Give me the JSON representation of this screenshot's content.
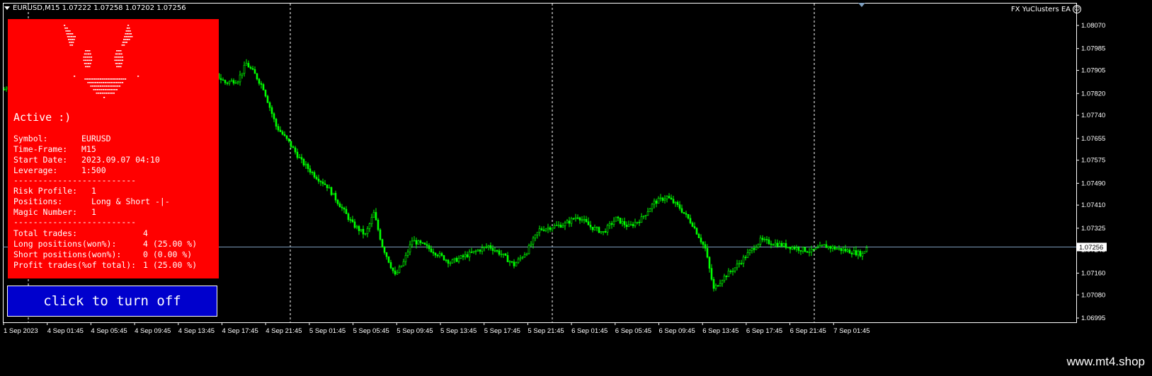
{
  "header": {
    "symbol_line": "EURUSD,M15  1.07222 1.07258 1.07202 1.07256"
  },
  "ea_label": {
    "text": "FX YuClusters EA",
    "icon": "smiley-icon"
  },
  "info_panel": {
    "status": "Active :)",
    "rows1": [
      {
        "key": "Symbol:",
        "value": "EURUSD"
      },
      {
        "key": "Time-Frame:",
        "value": "M15"
      },
      {
        "key": "Start Date:",
        "value": "2023.09.07 04:10"
      },
      {
        "key": "Leverage:",
        "value": "1:500"
      }
    ],
    "separator": "-------------------------",
    "rows2": [
      {
        "key": "Risk Profile:",
        "value": "1"
      },
      {
        "key": "Positions:",
        "value": "Long & Short -|-"
      },
      {
        "key": "Magic Number:",
        "value": "1"
      }
    ],
    "rows3": [
      {
        "key": "Total trades:",
        "value": "4"
      },
      {
        "key": "Long positions(won%):",
        "value": "4 (25.00 %)"
      },
      {
        "key": "Short positions(won%):",
        "value": "0 (0.00 %)"
      },
      {
        "key": "Profit trades(%of total):",
        "value": "1 (25.00 %)"
      }
    ],
    "panel_color": "#ff0000"
  },
  "toggle_button": {
    "label": "click to turn off",
    "color": "#0000cd"
  },
  "watermark": "www.mt4.shop",
  "chart_data": {
    "type": "candlestick",
    "symbol": "EURUSD",
    "timeframe": "M15",
    "ylim": [
      1.06995,
      1.0807
    ],
    "y_ticks": [
      "1.08070",
      "1.07985",
      "1.07905",
      "1.07820",
      "1.07740",
      "1.07655",
      "1.07575",
      "1.07490",
      "1.07410",
      "1.07325",
      "1.07245",
      "1.07160",
      "1.07080",
      "1.06995"
    ],
    "current_price": "1.07256",
    "x_ticks": [
      "1 Sep 2023",
      "4 Sep 01:45",
      "4 Sep 05:45",
      "4 Sep 09:45",
      "4 Sep 13:45",
      "4 Sep 17:45",
      "4 Sep 21:45",
      "5 Sep 01:45",
      "5 Sep 05:45",
      "5 Sep 09:45",
      "5 Sep 13:45",
      "5 Sep 17:45",
      "5 Sep 21:45",
      "6 Sep 01:45",
      "6 Sep 05:45",
      "6 Sep 09:45",
      "6 Sep 13:45",
      "6 Sep 17:45",
      "6 Sep 21:45",
      "7 Sep 01:45"
    ],
    "candle_color": "#00ff00",
    "price_path": [
      [
        0,
        1.07835
      ],
      [
        4,
        1.0787
      ],
      [
        8,
        1.0789
      ],
      [
        12,
        1.0786
      ],
      [
        14,
        1.0788
      ],
      [
        18,
        1.0785
      ],
      [
        22,
        1.07905
      ],
      [
        24,
        1.07985
      ],
      [
        28,
        1.0796
      ],
      [
        36,
        1.07955
      ],
      [
        44,
        1.07975
      ],
      [
        52,
        1.0796
      ],
      [
        60,
        1.0794
      ],
      [
        66,
        1.0795
      ],
      [
        70,
        1.07985
      ],
      [
        78,
        1.0796
      ],
      [
        86,
        1.0793
      ],
      [
        92,
        1.0792
      ],
      [
        98,
        1.079
      ],
      [
        104,
        1.0786
      ],
      [
        110,
        1.0787
      ],
      [
        114,
        1.0793
      ],
      [
        118,
        1.0789
      ],
      [
        122,
        1.0784
      ],
      [
        128,
        1.077
      ],
      [
        134,
        1.0764
      ],
      [
        140,
        1.0757
      ],
      [
        146,
        1.0752
      ],
      [
        152,
        1.0748
      ],
      [
        158,
        1.0741
      ],
      [
        164,
        1.0734
      ],
      [
        170,
        1.073
      ],
      [
        174,
        1.0738
      ],
      [
        178,
        1.0726
      ],
      [
        184,
        1.0715
      ],
      [
        188,
        1.072
      ],
      [
        192,
        1.0728
      ],
      [
        198,
        1.0726
      ],
      [
        204,
        1.0723
      ],
      [
        210,
        1.072
      ],
      [
        216,
        1.0722
      ],
      [
        222,
        1.0724
      ],
      [
        228,
        1.0726
      ],
      [
        234,
        1.0723
      ],
      [
        240,
        1.0719
      ],
      [
        246,
        1.0724
      ],
      [
        252,
        1.0732
      ],
      [
        258,
        1.0733
      ],
      [
        264,
        1.0734
      ],
      [
        270,
        1.0737
      ],
      [
        276,
        1.0733
      ],
      [
        282,
        1.0731
      ],
      [
        288,
        1.0736
      ],
      [
        294,
        1.0733
      ],
      [
        300,
        1.0736
      ],
      [
        306,
        1.0742
      ],
      [
        312,
        1.0744
      ],
      [
        318,
        1.074
      ],
      [
        324,
        1.0734
      ],
      [
        330,
        1.0725
      ],
      [
        334,
        1.071
      ],
      [
        338,
        1.0714
      ],
      [
        344,
        1.0718
      ],
      [
        350,
        1.0723
      ],
      [
        356,
        1.0728
      ],
      [
        362,
        1.0727
      ],
      [
        368,
        1.0726
      ],
      [
        374,
        1.0725
      ],
      [
        380,
        1.0724
      ],
      [
        386,
        1.0726
      ],
      [
        392,
        1.0725
      ],
      [
        398,
        1.0724
      ],
      [
        404,
        1.0723
      ],
      [
        406,
        1.07256
      ]
    ]
  }
}
